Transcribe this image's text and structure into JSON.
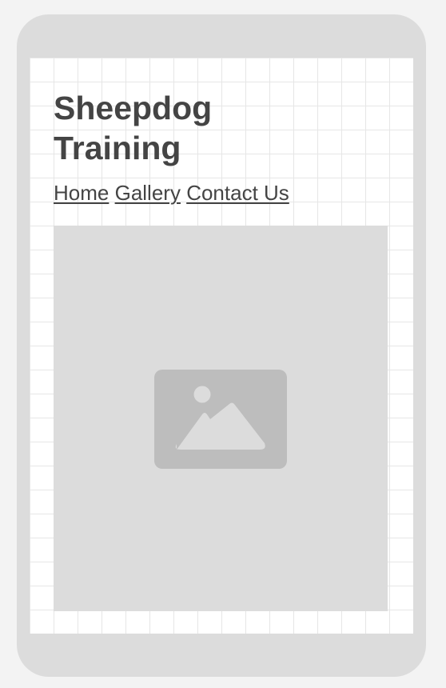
{
  "page": {
    "title": "Sheepdog Training",
    "nav": {
      "links": [
        "Home",
        "Gallery",
        "Contact Us"
      ]
    },
    "hero": {
      "icon": "image-placeholder-icon"
    }
  },
  "colors": {
    "background": "#f3f3f3",
    "device_frame": "#dcdcdc",
    "screen": "#ffffff",
    "grid": "#e6e6e6",
    "text": "#444444",
    "image_placeholder": "#dcdcdc",
    "image_icon": "#bdbdbd"
  }
}
